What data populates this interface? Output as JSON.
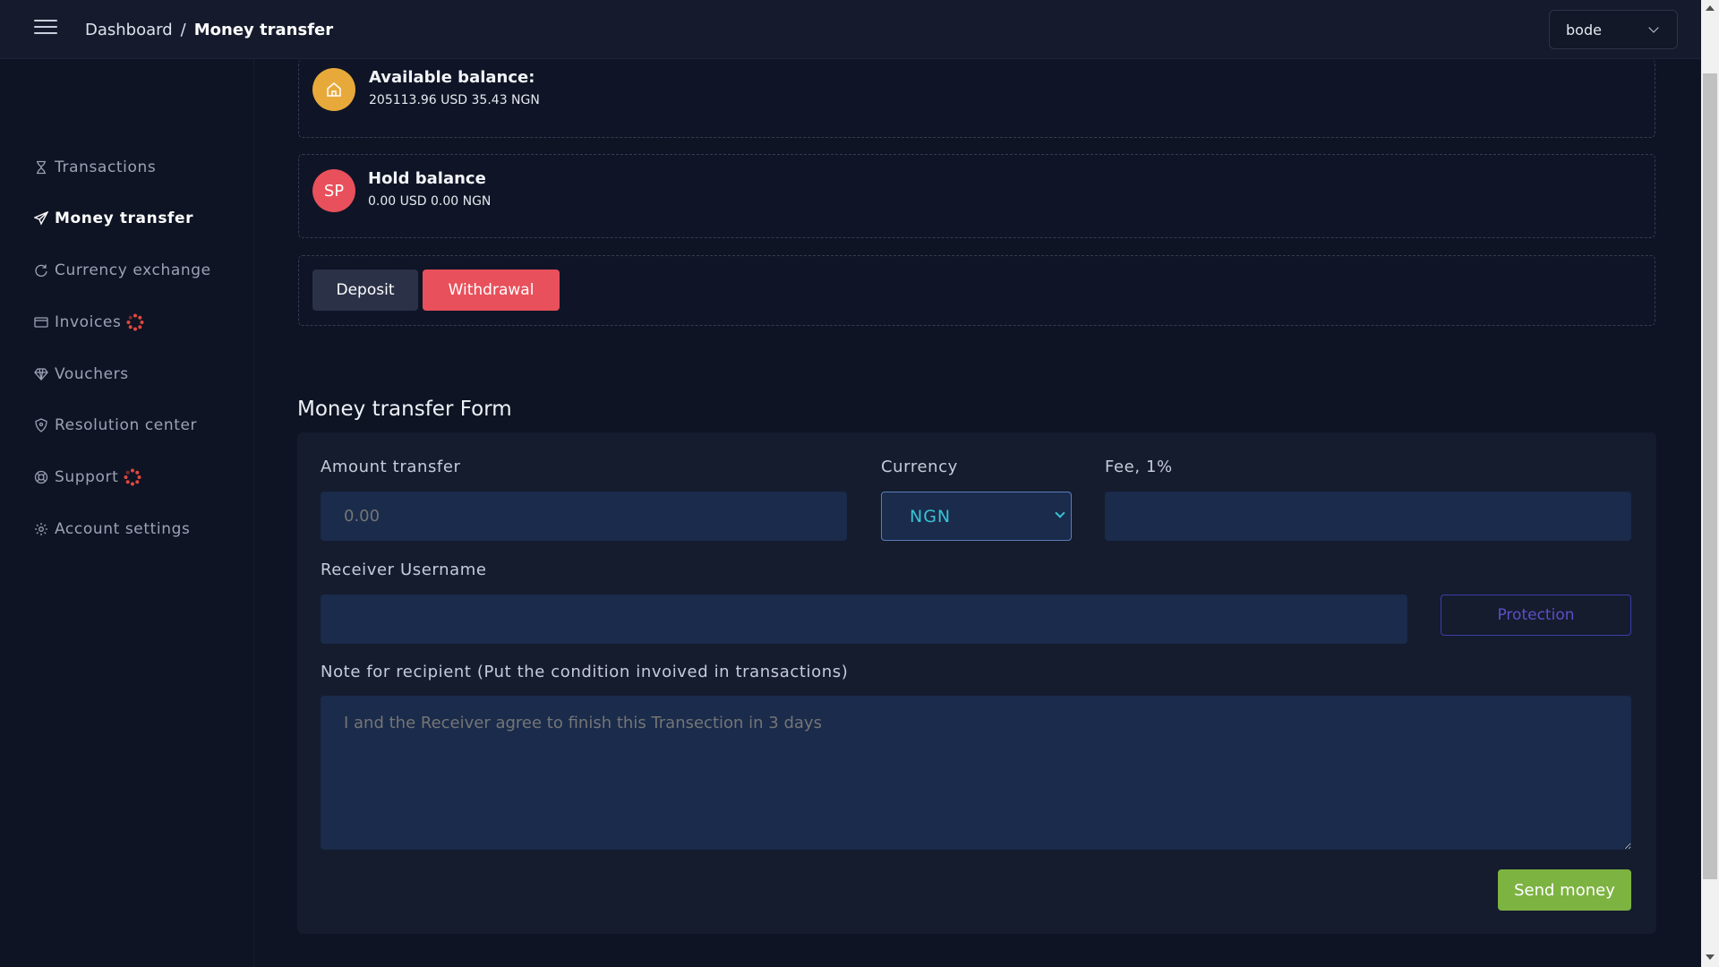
{
  "header": {
    "breadcrumb_root": "Dashboard",
    "breadcrumb_separator": "/",
    "breadcrumb_current": "Money transfer",
    "user_selected": "bode"
  },
  "sidebar": {
    "items": [
      {
        "label": "Transactions",
        "icon": "hourglass-icon"
      },
      {
        "label": "Money transfer",
        "icon": "paper-plane-icon",
        "active": true
      },
      {
        "label": "Currency exchange",
        "icon": "refresh-icon"
      },
      {
        "label": "Invoices",
        "icon": "credit-card-icon",
        "badge": "spinner-icon"
      },
      {
        "label": "Vouchers",
        "icon": "diamond-icon"
      },
      {
        "label": "Resolution center",
        "icon": "shield-icon"
      },
      {
        "label": "Support",
        "icon": "lifebuoy-icon",
        "badge": "spinner-icon"
      },
      {
        "label": "Account settings",
        "icon": "gear-icon"
      }
    ]
  },
  "balances": {
    "available_title": "Available balance:",
    "available_value": "205113.96 USD 35.43 NGN",
    "available_avatar_icon": "home-icon",
    "hold_avatar": "SP",
    "hold_title": "Hold balance",
    "hold_value": "0.00 USD 0.00 NGN"
  },
  "actions": {
    "deposit_label": "Deposit",
    "withdraw_label": "Withdrawal"
  },
  "form": {
    "title": "Money transfer Form",
    "amount_label": "Amount transfer",
    "amount_placeholder": "0.00",
    "currency_label": "Currency",
    "currency_value": "NGN",
    "fee_label": "Fee, 1%",
    "fee_value": "",
    "receiver_label": "Receiver Username",
    "receiver_value": "",
    "protection_label": "Protection",
    "note_label": "Note for recipient (Put the condition invoived in transactions)",
    "note_placeholder": "I and the Receiver agree to finish this Transection in 3 days",
    "send_label": "Send money"
  },
  "colors": {
    "background": "#0e1424",
    "accent_gold": "#e8a93b",
    "accent_red": "#e8505b",
    "send_green": "#7cb341",
    "field_blue": "#1a2b4b"
  }
}
